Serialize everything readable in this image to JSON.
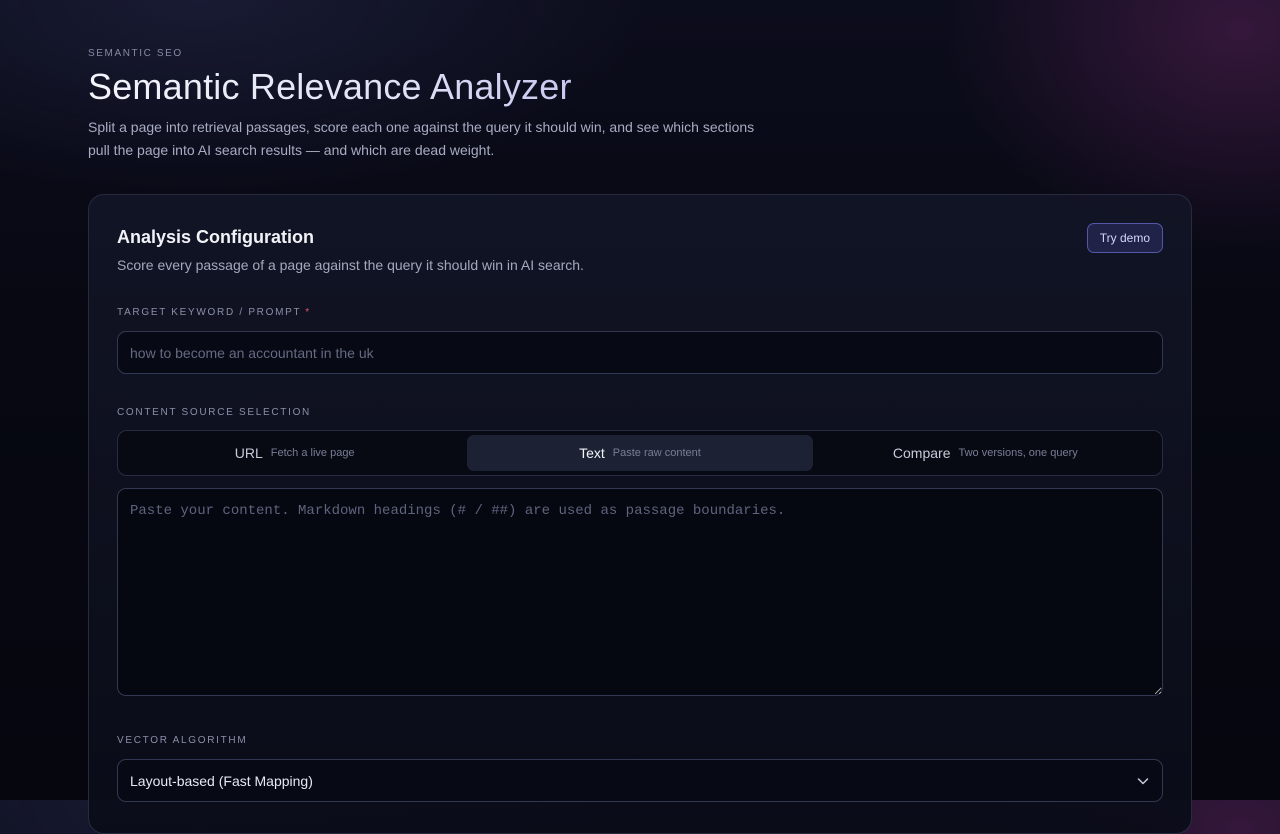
{
  "header": {
    "eyebrow": "SEMANTIC SEO",
    "title": "Semantic Relevance Analyzer",
    "subtitle": "Split a page into retrieval passages, score each one against the query it should win, and see which sections pull the page into AI search results — and which are dead weight."
  },
  "config": {
    "title": "Analysis Configuration",
    "subtitle": "Score every passage of a page against the query it should win in AI search.",
    "demo_label": "Try demo",
    "keyword": {
      "label": "TARGET KEYWORD / PROMPT",
      "required_mark": "*",
      "value": "",
      "placeholder": "how to become an accountant in the uk"
    },
    "source": {
      "label": "CONTENT SOURCE SELECTION",
      "tabs": [
        {
          "name": "URL",
          "desc": "Fetch a live page",
          "active": false
        },
        {
          "name": "Text",
          "desc": "Paste raw content",
          "active": true
        },
        {
          "name": "Compare",
          "desc": "Two versions, one query",
          "active": false
        }
      ],
      "content_value": "",
      "content_placeholder": "Paste your content. Markdown headings (# / ##) are used as passage boundaries."
    },
    "algorithm": {
      "label": "VECTOR ALGORITHM",
      "selected": "Layout-based (Fast Mapping)"
    }
  },
  "icons": {
    "select_arrow": "chevron-down-icon"
  },
  "colors": {
    "accent": "#5457a8",
    "required": "#e0566a",
    "active_tab": "#1c2234"
  }
}
